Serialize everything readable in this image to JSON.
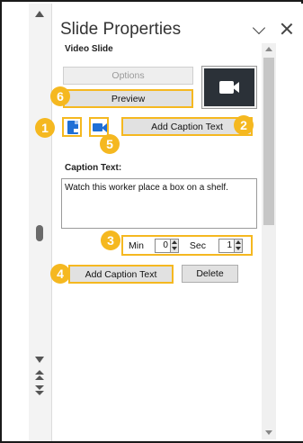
{
  "panel": {
    "title": "Slide Properties",
    "section_title": "Video Slide",
    "buttons": {
      "options": "Options",
      "preview": "Preview",
      "add_caption_text_top": "Add Caption Text",
      "add_caption_text_bottom": "Add Caption Text",
      "delete": "Delete"
    },
    "caption_label": "Caption Text:",
    "caption_value": "Watch this worker place a box on a shelf.",
    "time": {
      "min_label": "Min",
      "min_value": "0",
      "sec_label": "Sec",
      "sec_value": "1"
    }
  },
  "callouts": [
    "1",
    "2",
    "3",
    "4",
    "5",
    "6"
  ],
  "colors": {
    "highlight": "#f5b820",
    "icon_blue": "#1f6fd6",
    "video_thumb_bg": "#2b3138"
  },
  "icons": [
    "chevron-down-icon",
    "close-icon",
    "video-camera-icon",
    "caption-document-icon",
    "video-caption-icon"
  ]
}
